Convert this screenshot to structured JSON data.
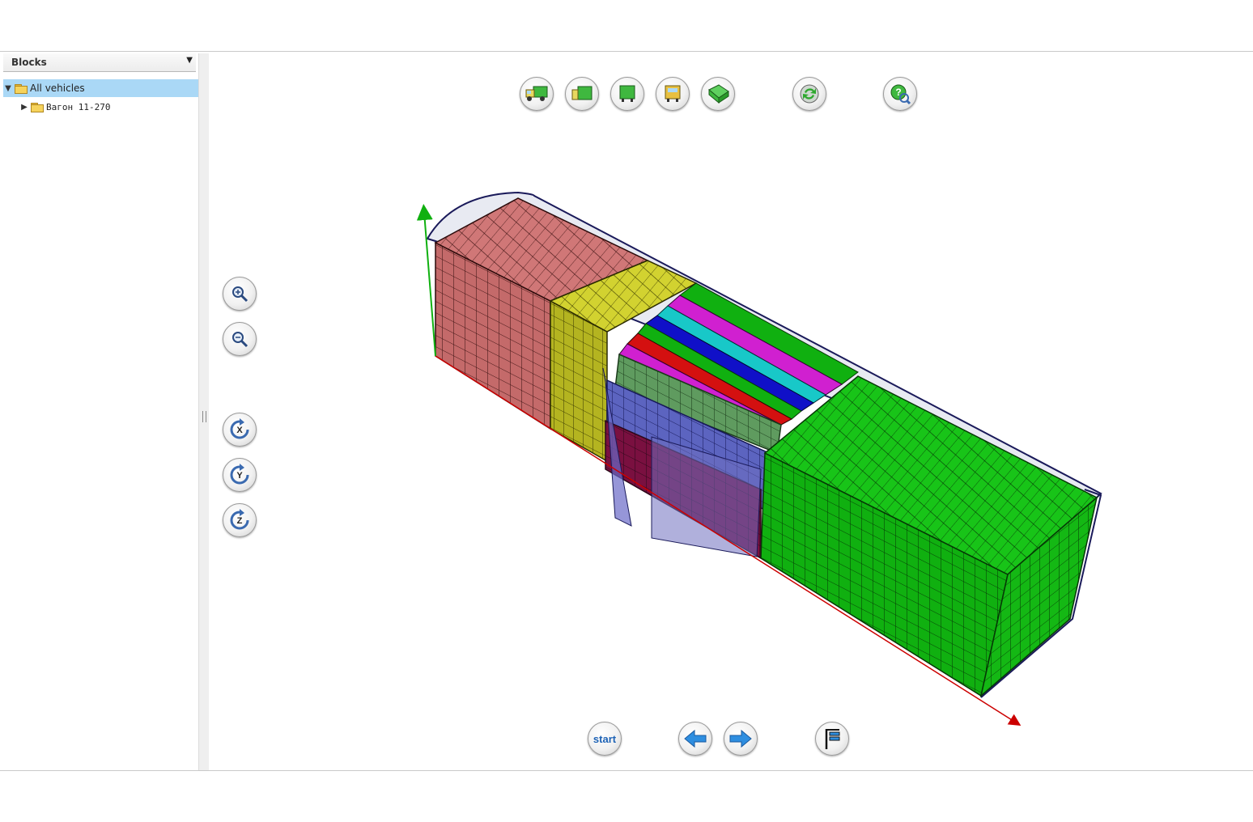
{
  "sidebar": {
    "title": "Blocks",
    "collapse_icon": "triangle-down-icon",
    "tree": [
      {
        "label": "All vehicles",
        "expanded": true,
        "selected": true
      },
      {
        "label": "Вагон 11-270",
        "expanded": false,
        "selected": false
      }
    ]
  },
  "toolbar_top": {
    "buttons": [
      "truck-view-icon",
      "side-view-icon",
      "front-view-icon",
      "back-view-icon",
      "iso-view-icon",
      "refresh-icon",
      "help-search-icon"
    ]
  },
  "toolbar_left": {
    "buttons": [
      "zoom-in-icon",
      "zoom-out-icon",
      "rotate-x-icon",
      "rotate-y-icon",
      "rotate-z-icon"
    ],
    "axis_letters": [
      "X",
      "Y",
      "Z"
    ]
  },
  "toolbar_bottom": {
    "start_label": "start",
    "buttons": [
      "arrow-left-icon",
      "arrow-right-icon",
      "finish-flag-icon"
    ]
  },
  "colors": {
    "selection": "#aad8f6",
    "cargo_pink": "#c46a6a",
    "cargo_olive": "#b8b820",
    "cargo_green": "#12b312",
    "cargo_blue": "#1010d0",
    "cargo_cyan": "#18c8c8",
    "cargo_magenta": "#d020d0",
    "cargo_red": "#d41010",
    "axis_x": "#cc0000",
    "axis_y": "#10b010"
  }
}
